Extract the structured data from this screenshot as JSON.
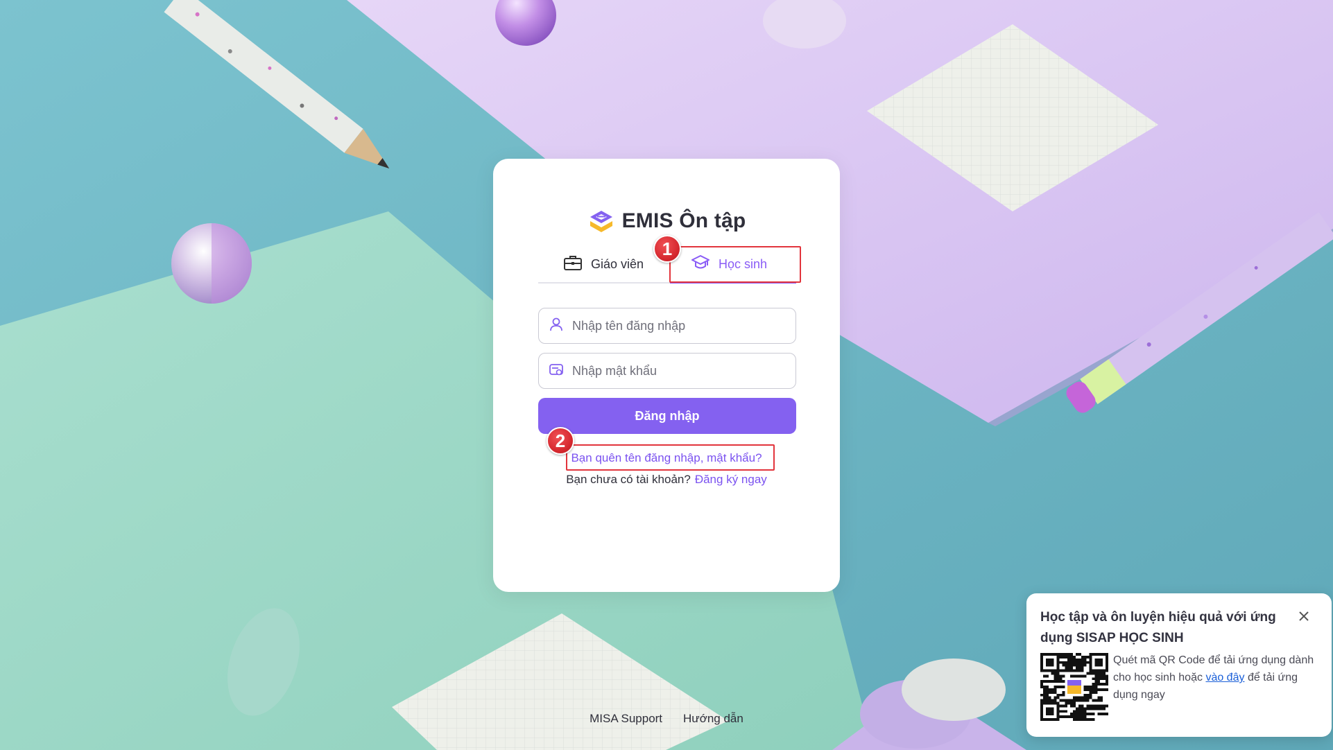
{
  "brand": {
    "name": "EMIS Ôn tập"
  },
  "tabs": {
    "teacher": "Giáo viên",
    "student": "Học sinh",
    "active": "student"
  },
  "form": {
    "username_placeholder": "Nhập tên đăng nhập",
    "password_placeholder": "Nhập mật khẩu",
    "login_label": "Đăng nhập",
    "forgot_label": "Bạn quên tên đăng nhập, mật khẩu?",
    "no_account_label": "Bạn chưa có tài khoản?",
    "register_label": "Đăng ký ngay"
  },
  "annotations": {
    "marker1": "1",
    "marker2": "2"
  },
  "footer": {
    "support": "MISA Support",
    "guide": "Hướng dẫn"
  },
  "popup": {
    "title": "Học tập và ôn luyện hiệu quả với ứng dụng SISAP HỌC SINH",
    "text_before": "Quét mã QR Code để tải ứng dụng dành cho học sinh hoặc",
    "link": "vào đây",
    "text_after": "để tải ứng dụng ngay"
  },
  "colors": {
    "accent": "#8461f0",
    "link": "#7b52f0",
    "highlight": "#e2343c",
    "bg_teal": "#6fb8c6",
    "bg_lilac": "#d9c6f2",
    "bg_mint": "#9ed8c7"
  },
  "icons": {
    "logo": "emis-logo-icon",
    "teacher": "briefcase-icon",
    "student": "graduation-cap-icon",
    "user": "user-icon",
    "password": "password-icon",
    "close": "close-icon",
    "qr": "qr-code-icon"
  }
}
